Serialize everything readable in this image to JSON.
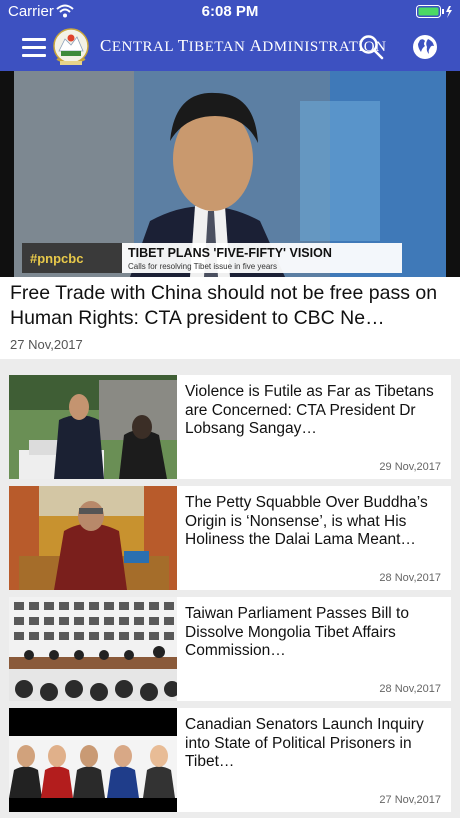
{
  "status": {
    "carrier": "Carrier",
    "time": "6:08 PM"
  },
  "nav": {
    "title_first": "C",
    "title_word1": "ENTRAL ",
    "title_t": "T",
    "title_word2": "IBETAN ",
    "title_a": "A",
    "title_word3": "DMINISTRATION"
  },
  "hero": {
    "image_caption_logo": "#pnpcbc",
    "image_caption_title": "TIBET PLANS 'FIVE-FIFTY' VISION",
    "image_caption_sub": "Calls for resolving Tibet issue in five years",
    "title": "Free Trade with China should not be free pass on Human Rights: CTA president to CBC Ne…",
    "date": "27 Nov,2017"
  },
  "articles": [
    {
      "title": "Violence is Futile as Far as Tibetans are Concerned: CTA President Dr Lobsang Sangay…",
      "date": "29 Nov,2017"
    },
    {
      "title": "The Petty Squabble Over Buddha’s Origin is ‘Nonsense’, is what His Holiness the Dalai Lama Meant…",
      "date": "28 Nov,2017"
    },
    {
      "title": "Taiwan Parliament Passes Bill to Dissolve Mongolia Tibet Affairs Commission…",
      "date": "28 Nov,2017"
    },
    {
      "title": "Canadian Senators Launch Inquiry into State of Political Prisoners in Tibet…",
      "date": "27 Nov,2017"
    }
  ],
  "colors": {
    "header": "#3d51c1",
    "background": "#ececec"
  },
  "icons": [
    "wifi-icon",
    "battery-icon",
    "menu-icon",
    "search-icon",
    "globe-icon"
  ]
}
